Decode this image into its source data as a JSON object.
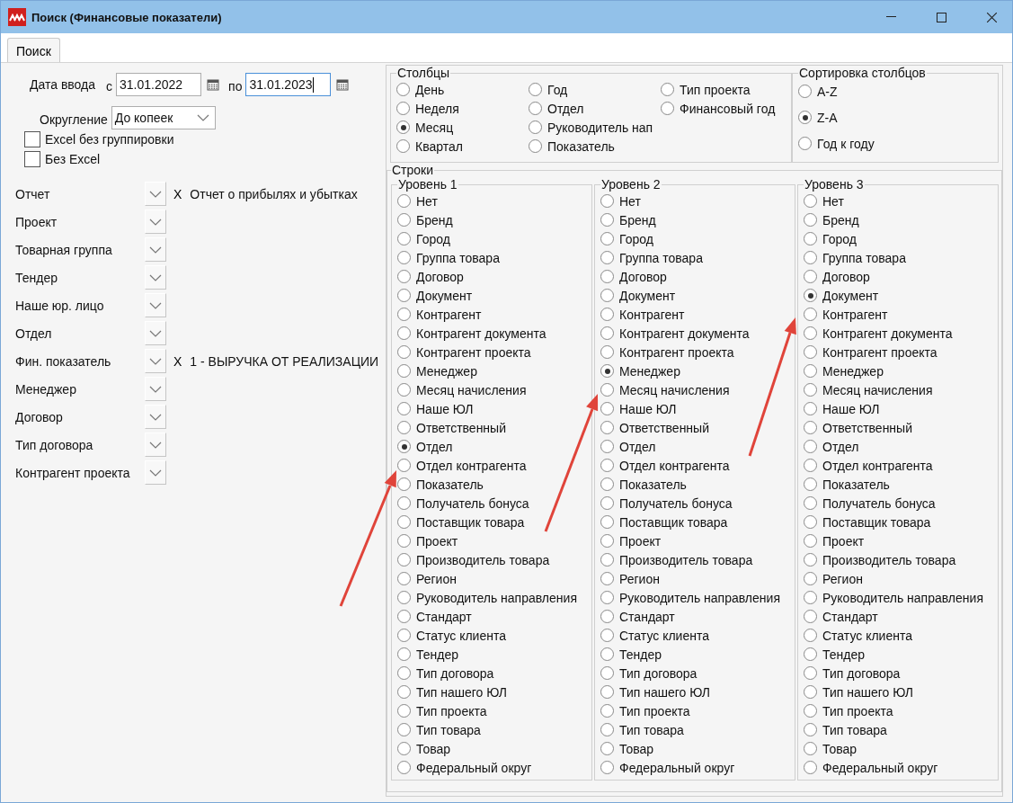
{
  "window": {
    "title": "Поиск (Финансовые показатели)"
  },
  "tabs": [
    {
      "label": "Поиск",
      "selected": true
    }
  ],
  "date_filter": {
    "label": "Дата ввода",
    "fields": [
      {
        "prefix": "с",
        "value": "31.01.2022",
        "focused": false
      },
      {
        "prefix": "по",
        "value": "31.01.2023",
        "focused": true
      }
    ]
  },
  "rounding": {
    "label": "Округление",
    "value": "До копеек"
  },
  "checkboxes": [
    {
      "label": "Excel без группировки",
      "checked": false
    },
    {
      "label": "Без Excel",
      "checked": false
    }
  ],
  "filters": [
    {
      "label": "Отчет",
      "clear": "X",
      "value": "Отчет о прибылях и убытках"
    },
    {
      "label": "Проект"
    },
    {
      "label": "Товарная группа"
    },
    {
      "label": "Тендер"
    },
    {
      "label": "Наше юр. лицо"
    },
    {
      "label": "Отдел"
    },
    {
      "label": "Фин. показатель",
      "clear": "X",
      "value": "1 - ВЫРУЧКА ОТ РЕАЛИЗАЦИИ"
    },
    {
      "label": "Менеджер"
    },
    {
      "label": "Договор"
    },
    {
      "label": "Тип договора"
    },
    {
      "label": "Контрагент проекта"
    }
  ],
  "columns": {
    "title": "Столбцы",
    "options": [
      {
        "label": "День",
        "selected": false
      },
      {
        "label": "Неделя",
        "selected": false
      },
      {
        "label": "Месяц",
        "selected": true
      },
      {
        "label": "Квартал",
        "selected": false
      },
      {
        "label": "Год",
        "selected": false
      },
      {
        "label": "Отдел",
        "selected": false
      },
      {
        "label": "Руководитель нап",
        "selected": false
      },
      {
        "label": "Показатель",
        "selected": false
      },
      {
        "label": "Тип проекта",
        "selected": false
      },
      {
        "label": "Финансовый год",
        "selected": false
      }
    ]
  },
  "sort": {
    "title": "Сортировка столбцов",
    "options": [
      {
        "label": "A-Z",
        "selected": false
      },
      {
        "label": "Z-A",
        "selected": true
      },
      {
        "label": "Год к году",
        "selected": false
      }
    ]
  },
  "rows": {
    "title": "Строки",
    "levels": [
      {
        "title": "Уровень 1",
        "options": [
          {
            "label": "Нет",
            "selected": false
          },
          {
            "label": "Бренд",
            "selected": false
          },
          {
            "label": "Город",
            "selected": false
          },
          {
            "label": "Группа товара",
            "selected": false
          },
          {
            "label": "Договор",
            "selected": false
          },
          {
            "label": "Документ",
            "selected": false
          },
          {
            "label": "Контрагент",
            "selected": false
          },
          {
            "label": "Контрагент документа",
            "selected": false
          },
          {
            "label": "Контрагент проекта",
            "selected": false
          },
          {
            "label": "Менеджер",
            "selected": false
          },
          {
            "label": "Месяц начисления",
            "selected": false
          },
          {
            "label": "Наше ЮЛ",
            "selected": false
          },
          {
            "label": "Ответственный",
            "selected": false
          },
          {
            "label": "Отдел",
            "selected": true
          },
          {
            "label": "Отдел контрагента",
            "selected": false
          },
          {
            "label": "Показатель",
            "selected": false
          },
          {
            "label": "Получатель бонуса",
            "selected": false
          },
          {
            "label": "Поставщик товара",
            "selected": false
          },
          {
            "label": "Проект",
            "selected": false
          },
          {
            "label": "Производитель товара",
            "selected": false
          },
          {
            "label": "Регион",
            "selected": false
          },
          {
            "label": "Руководитель направления",
            "selected": false
          },
          {
            "label": "Стандарт",
            "selected": false
          },
          {
            "label": "Статус клиента",
            "selected": false
          },
          {
            "label": "Тендер",
            "selected": false
          },
          {
            "label": "Тип договора",
            "selected": false
          },
          {
            "label": "Тип нашего ЮЛ",
            "selected": false
          },
          {
            "label": "Тип проекта",
            "selected": false
          },
          {
            "label": "Тип товара",
            "selected": false
          },
          {
            "label": "Товар",
            "selected": false
          },
          {
            "label": "Федеральный округ",
            "selected": false
          }
        ]
      },
      {
        "title": "Уровень 2",
        "options": [
          {
            "label": "Нет",
            "selected": false
          },
          {
            "label": "Бренд",
            "selected": false
          },
          {
            "label": "Город",
            "selected": false
          },
          {
            "label": "Группа товара",
            "selected": false
          },
          {
            "label": "Договор",
            "selected": false
          },
          {
            "label": "Документ",
            "selected": false
          },
          {
            "label": "Контрагент",
            "selected": false
          },
          {
            "label": "Контрагент документа",
            "selected": false
          },
          {
            "label": "Контрагент проекта",
            "selected": false
          },
          {
            "label": "Менеджер",
            "selected": true
          },
          {
            "label": "Месяц начисления",
            "selected": false
          },
          {
            "label": "Наше ЮЛ",
            "selected": false
          },
          {
            "label": "Ответственный",
            "selected": false
          },
          {
            "label": "Отдел",
            "selected": false
          },
          {
            "label": "Отдел контрагента",
            "selected": false
          },
          {
            "label": "Показатель",
            "selected": false
          },
          {
            "label": "Получатель бонуса",
            "selected": false
          },
          {
            "label": "Поставщик товара",
            "selected": false
          },
          {
            "label": "Проект",
            "selected": false
          },
          {
            "label": "Производитель товара",
            "selected": false
          },
          {
            "label": "Регион",
            "selected": false
          },
          {
            "label": "Руководитель направления",
            "selected": false
          },
          {
            "label": "Стандарт",
            "selected": false
          },
          {
            "label": "Статус клиента",
            "selected": false
          },
          {
            "label": "Тендер",
            "selected": false
          },
          {
            "label": "Тип договора",
            "selected": false
          },
          {
            "label": "Тип нашего ЮЛ",
            "selected": false
          },
          {
            "label": "Тип проекта",
            "selected": false
          },
          {
            "label": "Тип товара",
            "selected": false
          },
          {
            "label": "Товар",
            "selected": false
          },
          {
            "label": "Федеральный округ",
            "selected": false
          }
        ]
      },
      {
        "title": "Уровень 3",
        "options": [
          {
            "label": "Нет",
            "selected": false
          },
          {
            "label": "Бренд",
            "selected": false
          },
          {
            "label": "Город",
            "selected": false
          },
          {
            "label": "Группа товара",
            "selected": false
          },
          {
            "label": "Договор",
            "selected": false
          },
          {
            "label": "Документ",
            "selected": true
          },
          {
            "label": "Контрагент",
            "selected": false
          },
          {
            "label": "Контрагент документа",
            "selected": false
          },
          {
            "label": "Контрагент проекта",
            "selected": false
          },
          {
            "label": "Менеджер",
            "selected": false
          },
          {
            "label": "Месяц начисления",
            "selected": false
          },
          {
            "label": "Наше ЮЛ",
            "selected": false
          },
          {
            "label": "Ответственный",
            "selected": false
          },
          {
            "label": "Отдел",
            "selected": false
          },
          {
            "label": "Отдел контрагента",
            "selected": false
          },
          {
            "label": "Показатель",
            "selected": false
          },
          {
            "label": "Получатель бонуса",
            "selected": false
          },
          {
            "label": "Поставщик товара",
            "selected": false
          },
          {
            "label": "Проект",
            "selected": false
          },
          {
            "label": "Производитель товара",
            "selected": false
          },
          {
            "label": "Регион",
            "selected": false
          },
          {
            "label": "Руководитель направления",
            "selected": false
          },
          {
            "label": "Стандарт",
            "selected": false
          },
          {
            "label": "Статус клиента",
            "selected": false
          },
          {
            "label": "Тендер",
            "selected": false
          },
          {
            "label": "Тип договора",
            "selected": false
          },
          {
            "label": "Тип нашего ЮЛ",
            "selected": false
          },
          {
            "label": "Тип проекта",
            "selected": false
          },
          {
            "label": "Тип товара",
            "selected": false
          },
          {
            "label": "Товар",
            "selected": false
          },
          {
            "label": "Федеральный округ",
            "selected": false
          }
        ]
      }
    ]
  }
}
